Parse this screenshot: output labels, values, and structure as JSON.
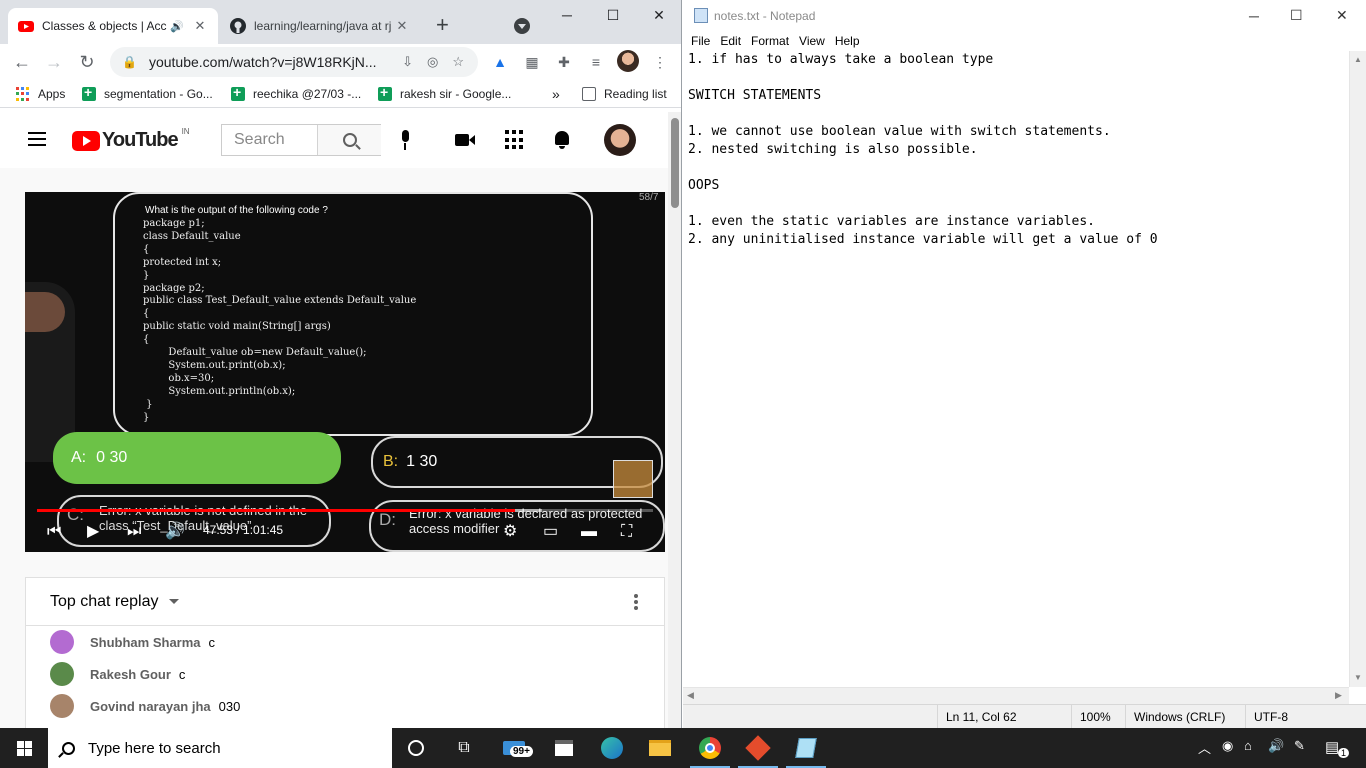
{
  "browser": {
    "tabs": [
      {
        "title": "Classes & objects | Acc",
        "favicon": "youtube-icon",
        "active": true
      },
      {
        "title": "learning/learning/java at rj",
        "favicon": "github-icon",
        "active": false
      }
    ],
    "new_tab": "+",
    "address": "youtube.com/watch?v=j8W18RKjN...",
    "bookmarks": [
      {
        "label": "Apps",
        "icon": "apps-grid-icon"
      },
      {
        "label": "segmentation - Go...",
        "icon": "sheets-icon"
      },
      {
        "label": "reechika @27/03 -...",
        "icon": "sheets-icon"
      },
      {
        "label": "rakesh sir - Google...",
        "icon": "sheets-icon"
      }
    ],
    "bookmarks_overflow": "»",
    "reading_list": "Reading list",
    "window_controls": {
      "minimize": "─",
      "maximize": "☐",
      "close": "✕"
    }
  },
  "youtube": {
    "logo_text": "YouTube",
    "country_code": "IN",
    "search_placeholder": "Search",
    "video": {
      "question": "What is the output of the following code ?",
      "code": "package p1;\nclass Default_value\n{\nprotected int x;\n}\npackage p2;\npublic class Test_Default_value extends Default_value\n{\npublic static void main(String[] args)\n{\n        Default_value ob=new Default_value();\n        System.out.print(ob.x);\n        ob.x=30;\n        System.out.println(ob.x);\n }\n}",
      "slide_counter": "58/7",
      "option_a_letter": "A:",
      "option_a_text": "0 30",
      "option_b_letter": "B:",
      "option_b_text": "1 30",
      "option_c_letter": "C:",
      "option_c_text": "Error: x variable is not defined in the class “Test_Default_value”",
      "option_d_letter": "D:",
      "option_d_text": "Error: x variable is declared as protected access modifier",
      "time_display": "47:53 / 1:01:45",
      "progress_played": 0.776,
      "progress_buffered": 0.82
    },
    "chat": {
      "header": "Top chat replay",
      "messages": [
        {
          "author": "Shubham Sharma",
          "text": "c",
          "avatar_color": "#b36bd1"
        },
        {
          "author": "Rakesh Gour",
          "text": "c",
          "avatar_color": "#5a8a4a"
        },
        {
          "author": "Govind narayan jha",
          "text": "030",
          "avatar_color": "#a7846a"
        }
      ]
    }
  },
  "notepad": {
    "title": "notes.txt - Notepad",
    "menu": [
      "File",
      "Edit",
      "Format",
      "View",
      "Help"
    ],
    "content": "1. if has to always take a boolean type\n\nSWITCH STATEMENTS\n\n1. we cannot use boolean value with switch statements.\n2. nested switching is also possible.\n\nOOPS\n\n1. even the static variables are instance variables.\n2. any uninitialised instance variable will get a value of 0",
    "status": {
      "position": "Ln 11, Col 62",
      "zoom": "100%",
      "line_endings": "Windows (CRLF)",
      "encoding": "UTF-8"
    }
  },
  "taskbar": {
    "search_placeholder": "Type here to search",
    "mail_badge": "99+",
    "notification_count": "1"
  },
  "colors": {
    "youtube_red": "#ff0000",
    "correct_option_green": "#6cc247",
    "taskbar_bg": "#202020"
  }
}
